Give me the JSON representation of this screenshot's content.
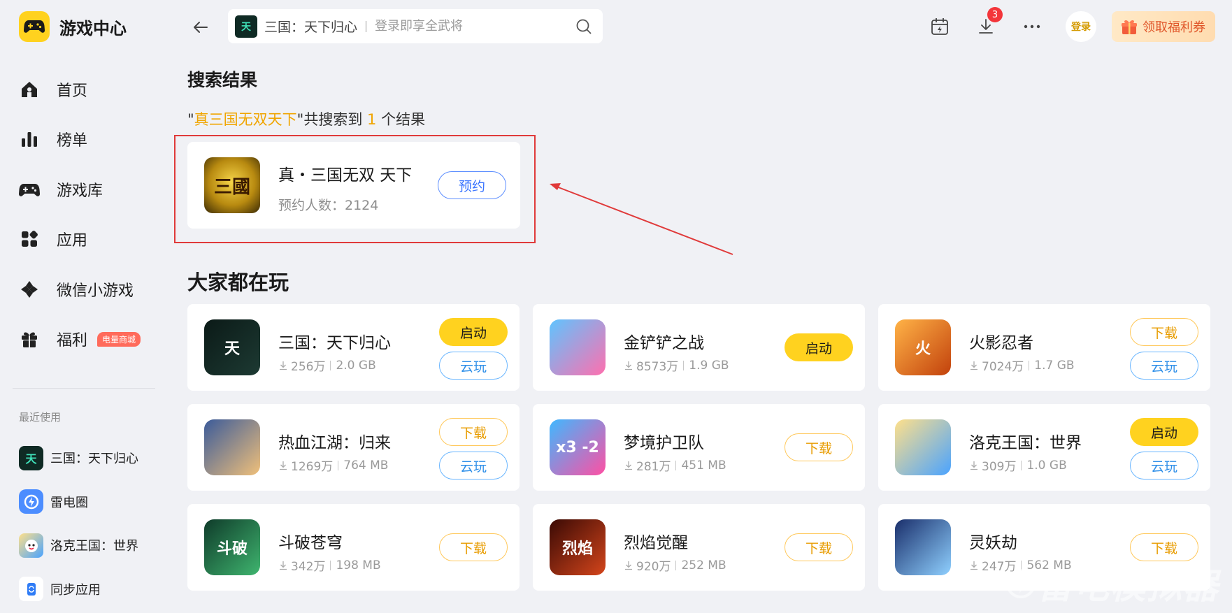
{
  "app": {
    "name": "游戏中心"
  },
  "sidebar": {
    "items": [
      {
        "label": "首页",
        "icon": "home-icon"
      },
      {
        "label": "榜单",
        "icon": "ranking-icon"
      },
      {
        "label": "游戏库",
        "icon": "gamepad-icon"
      },
      {
        "label": "应用",
        "icon": "apps-icon"
      },
      {
        "label": "微信小游戏",
        "icon": "mini-game-icon"
      },
      {
        "label": "福利",
        "icon": "gift-icon",
        "badge": "电量商城"
      }
    ],
    "recent_title": "最近使用",
    "recent": [
      {
        "label": "三国：天下归心"
      },
      {
        "label": "雷电圈"
      },
      {
        "label": "洛克王国：世界"
      },
      {
        "label": "同步应用"
      }
    ]
  },
  "search": {
    "term": "三国：天下归心",
    "placeholder": "登录即享全武将",
    "thumb_text": "天"
  },
  "topbar": {
    "download_badge": "3",
    "login_label": "登录",
    "coupon_label": "领取福利券"
  },
  "results": {
    "title": "搜索结果",
    "summary_quote_open": "\"",
    "query": "真三国无双天下",
    "summary_mid": "\"共搜索到 ",
    "count": "1",
    "summary_end": " 个结果",
    "item": {
      "name": "真・三国无双 天下",
      "meta": "预约人数：2124",
      "icon_text": "三國",
      "button": "预约"
    }
  },
  "popular": {
    "title": "大家都在玩",
    "games": [
      {
        "name": "三国：天下归心",
        "downloads": "256万",
        "size": "2.0 GB",
        "icon_text": "天",
        "colors": [
          "#0b1a17",
          "#1d3a33"
        ],
        "buttons": [
          {
            "label": "启动",
            "type": "launch"
          },
          {
            "label": "云玩",
            "type": "cloud"
          }
        ]
      },
      {
        "name": "金铲铲之战",
        "downloads": "8573万",
        "size": "1.9 GB",
        "icon_text": "",
        "colors": [
          "#5fc4ff",
          "#ff6fae"
        ],
        "buttons": [
          {
            "label": "启动",
            "type": "launch"
          }
        ]
      },
      {
        "name": "火影忍者",
        "downloads": "7024万",
        "size": "1.7 GB",
        "icon_text": "火",
        "colors": [
          "#ffb347",
          "#c2410c"
        ],
        "buttons": [
          {
            "label": "下载",
            "type": "download"
          },
          {
            "label": "云玩",
            "type": "cloud"
          }
        ]
      },
      {
        "name": "热血江湖：归来",
        "downloads": "1269万",
        "size": "764 MB",
        "icon_text": "",
        "colors": [
          "#3b5b9a",
          "#f0c07a"
        ],
        "buttons": [
          {
            "label": "下载",
            "type": "download"
          },
          {
            "label": "云玩",
            "type": "cloud"
          }
        ]
      },
      {
        "name": "梦境护卫队",
        "downloads": "281万",
        "size": "451 MB",
        "icon_text": "x3 -2",
        "colors": [
          "#3fb8ff",
          "#ff4fa3"
        ],
        "buttons": [
          {
            "label": "下载",
            "type": "download"
          }
        ]
      },
      {
        "name": "洛克王国：世界",
        "downloads": "309万",
        "size": "1.0 GB",
        "icon_text": "",
        "colors": [
          "#ffe08a",
          "#4aa3ff"
        ],
        "buttons": [
          {
            "label": "启动",
            "type": "launch"
          },
          {
            "label": "云玩",
            "type": "cloud"
          }
        ]
      },
      {
        "name": "斗破苍穹",
        "downloads": "342万",
        "size": "198 MB",
        "icon_text": "斗破",
        "colors": [
          "#0f3b2a",
          "#3fb56f"
        ],
        "buttons": [
          {
            "label": "下载",
            "type": "download"
          }
        ]
      },
      {
        "name": "烈焰觉醒",
        "downloads": "920万",
        "size": "252 MB",
        "icon_text": "烈焰",
        "colors": [
          "#3a0a05",
          "#d4451b"
        ],
        "buttons": [
          {
            "label": "下载",
            "type": "download"
          }
        ]
      },
      {
        "name": "灵妖劫",
        "downloads": "247万",
        "size": "562 MB",
        "icon_text": "",
        "colors": [
          "#1a2f6b",
          "#8fd0ff"
        ],
        "buttons": [
          {
            "label": "下载",
            "type": "download"
          }
        ]
      }
    ]
  },
  "watermark": "雷电模拟器",
  "colors": {
    "accent": "#ffd21f",
    "highlight": "#f0a500",
    "annotation": "#e03a3a"
  }
}
